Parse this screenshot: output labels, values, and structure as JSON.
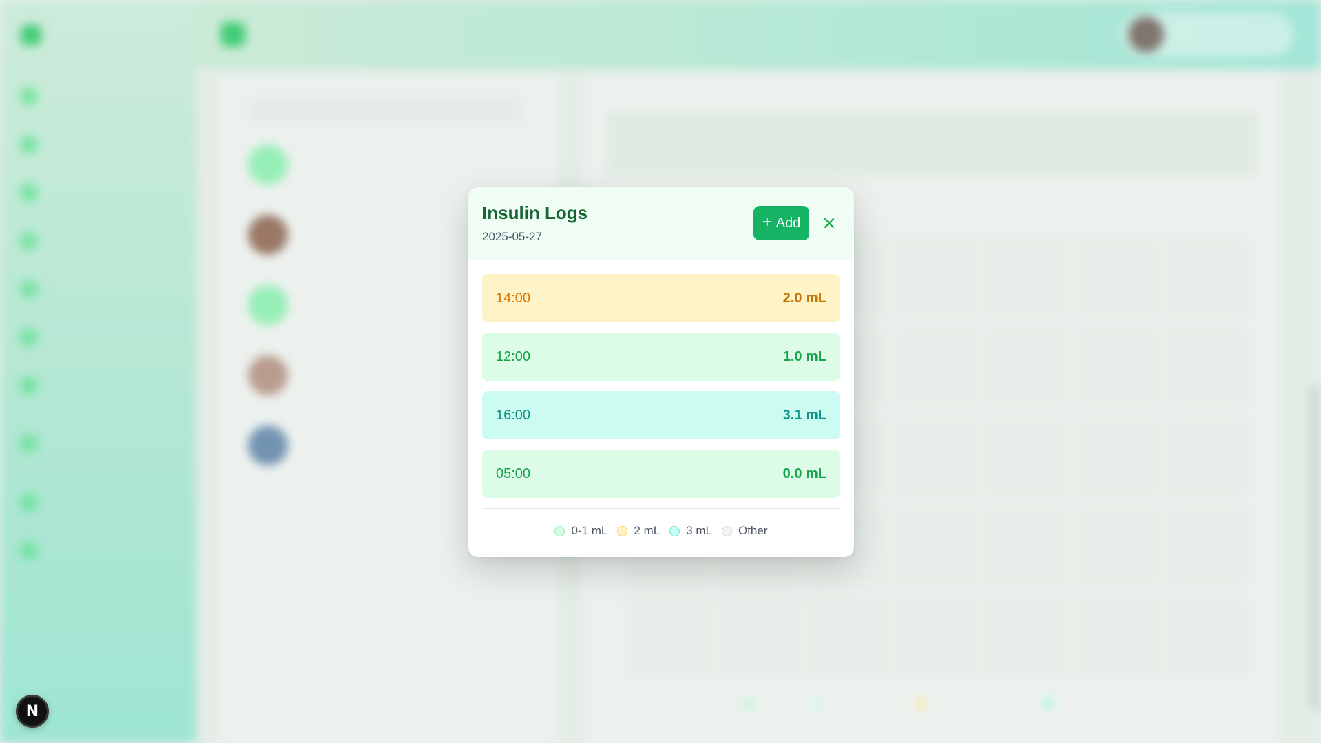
{
  "background": {
    "brand": "",
    "header_title": "",
    "profile_name": "",
    "nav_items": [
      "",
      "",
      "",
      "",
      "",
      "",
      "",
      "",
      "",
      ""
    ],
    "patients": [
      {
        "name": "",
        "sub": "",
        "avatar_color": "#86efac"
      },
      {
        "name": "",
        "sub": "",
        "avatar_color": "#8b5e4a"
      },
      {
        "name": "",
        "sub": "",
        "avatar_color": "#86efac"
      },
      {
        "name": "",
        "sub": "",
        "avatar_color": "#b08a7a"
      },
      {
        "name": "",
        "sub": "",
        "avatar_color": "#5b7fa8"
      }
    ],
    "calendar_title": "",
    "calendar_month": "",
    "legend": [
      "",
      "",
      "",
      ""
    ]
  },
  "modal": {
    "title": "Insulin Logs",
    "date": "2025-05-27",
    "add_label": "Add",
    "logs": [
      {
        "time": "14:00",
        "amount": "2.0 mL",
        "tone": "yellow"
      },
      {
        "time": "12:00",
        "amount": "1.0 mL",
        "tone": "green"
      },
      {
        "time": "16:00",
        "amount": "3.1 mL",
        "tone": "teal"
      },
      {
        "time": "05:00",
        "amount": "0.0 mL",
        "tone": "green"
      }
    ],
    "legend": [
      {
        "label": "0-1 mL",
        "fill": "#dcfce7",
        "border": "#86efac"
      },
      {
        "label": "2 mL",
        "fill": "#fef3c7",
        "border": "#fcd34d"
      },
      {
        "label": "3 mL",
        "fill": "#ccfbf1",
        "border": "#5eead4"
      },
      {
        "label": "Other",
        "fill": "#f3f4f6",
        "border": "#d1d5db"
      }
    ]
  },
  "colors": {
    "accent": "#16b364",
    "title": "#166534"
  },
  "badge": {
    "letter": "N"
  }
}
